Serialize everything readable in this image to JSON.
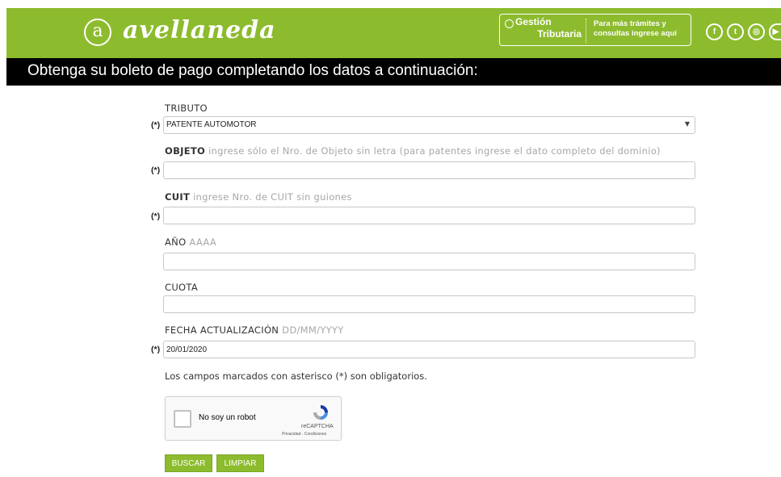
{
  "header": {
    "logo_letter": "a",
    "logo_text": "avellaneda",
    "gestion": {
      "title_line1": "Gestión",
      "title_line2": "Tributaria",
      "subtitle_line1": "Para más trámites y",
      "subtitle_line2": "consultas ingrese aquí"
    },
    "social": [
      {
        "icon": "facebook-icon",
        "glyph": "f"
      },
      {
        "icon": "twitter-icon",
        "glyph": "t"
      },
      {
        "icon": "instagram-icon",
        "glyph": "◎"
      },
      {
        "icon": "youtube-icon",
        "glyph": "▶"
      }
    ]
  },
  "page_title": "Obtenga su boleto de pago completando los datos a continuación:",
  "form": {
    "required_mark": "(*)",
    "tributo": {
      "label": "TRIBUTO",
      "value": "PATENTE AUTOMOTOR"
    },
    "objeto": {
      "label": "OBJETO",
      "hint": " ingrese sólo el Nro. de Objeto sin letra (para patentes ingrese el dato completo del dominio)",
      "value": ""
    },
    "cuit": {
      "label": "CUIT",
      "hint": " ingrese Nro. de CUIT sin guiones",
      "value": ""
    },
    "anio": {
      "label": "AÑO",
      "hint": " AAAA",
      "value": ""
    },
    "cuota": {
      "label": "CUOTA",
      "value": ""
    },
    "fecha": {
      "label": "FECHA ACTUALIZACIÓN",
      "hint": " DD/MM/YYYY",
      "value": "20/01/2020"
    },
    "note": "Los campos marcados con asterisco (*) son obligatorios."
  },
  "captcha": {
    "label": "No soy un robot",
    "brand": "reCAPTCHA",
    "links": "Privacidad - Condiciones"
  },
  "buttons": {
    "search": "BUSCAR",
    "clear": "LIMPIAR"
  },
  "colors": {
    "brand_green": "#8dbb2e",
    "title_bar": "#000000"
  }
}
